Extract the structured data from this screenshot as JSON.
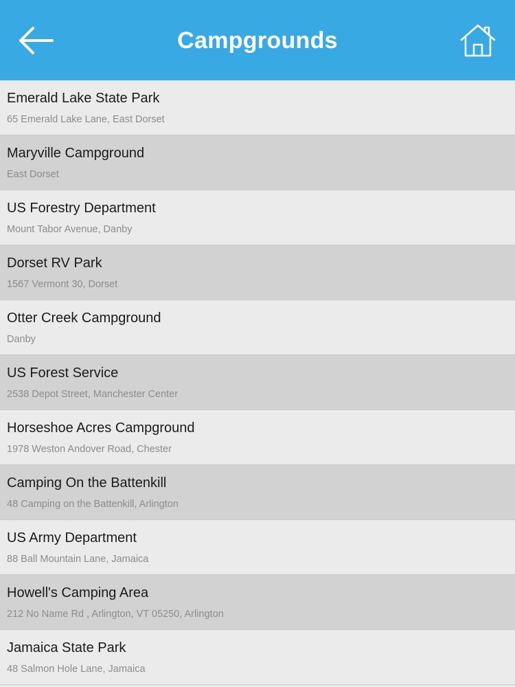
{
  "header": {
    "title": "Campgrounds",
    "back_icon": "arrow-left-icon",
    "home_icon": "home-icon",
    "background_color": "#39a9e4"
  },
  "campgrounds": [
    {
      "name": "Emerald Lake State Park",
      "address": "65 Emerald Lake Lane, East Dorset"
    },
    {
      "name": "Maryville Campground",
      "address": "East Dorset"
    },
    {
      "name": "US Forestry Department",
      "address": "Mount Tabor Avenue, Danby"
    },
    {
      "name": "Dorset RV Park",
      "address": "1567 Vermont 30, Dorset"
    },
    {
      "name": "Otter Creek Campground",
      "address": "Danby"
    },
    {
      "name": "US Forest Service",
      "address": "2538 Depot Street, Manchester Center"
    },
    {
      "name": "Horseshoe Acres Campground",
      "address": "1978 Weston Andover Road, Chester"
    },
    {
      "name": "Camping On the Battenkill",
      "address": "48 Camping on the Battenkill, Arlington"
    },
    {
      "name": "US Army Department",
      "address": "88 Ball Mountain Lane, Jamaica"
    },
    {
      "name": "Howell's Camping Area",
      "address": "212 No Name Rd , Arlington, VT 05250, Arlington"
    },
    {
      "name": "Jamaica State Park",
      "address": "48 Salmon Hole Lane, Jamaica"
    }
  ]
}
